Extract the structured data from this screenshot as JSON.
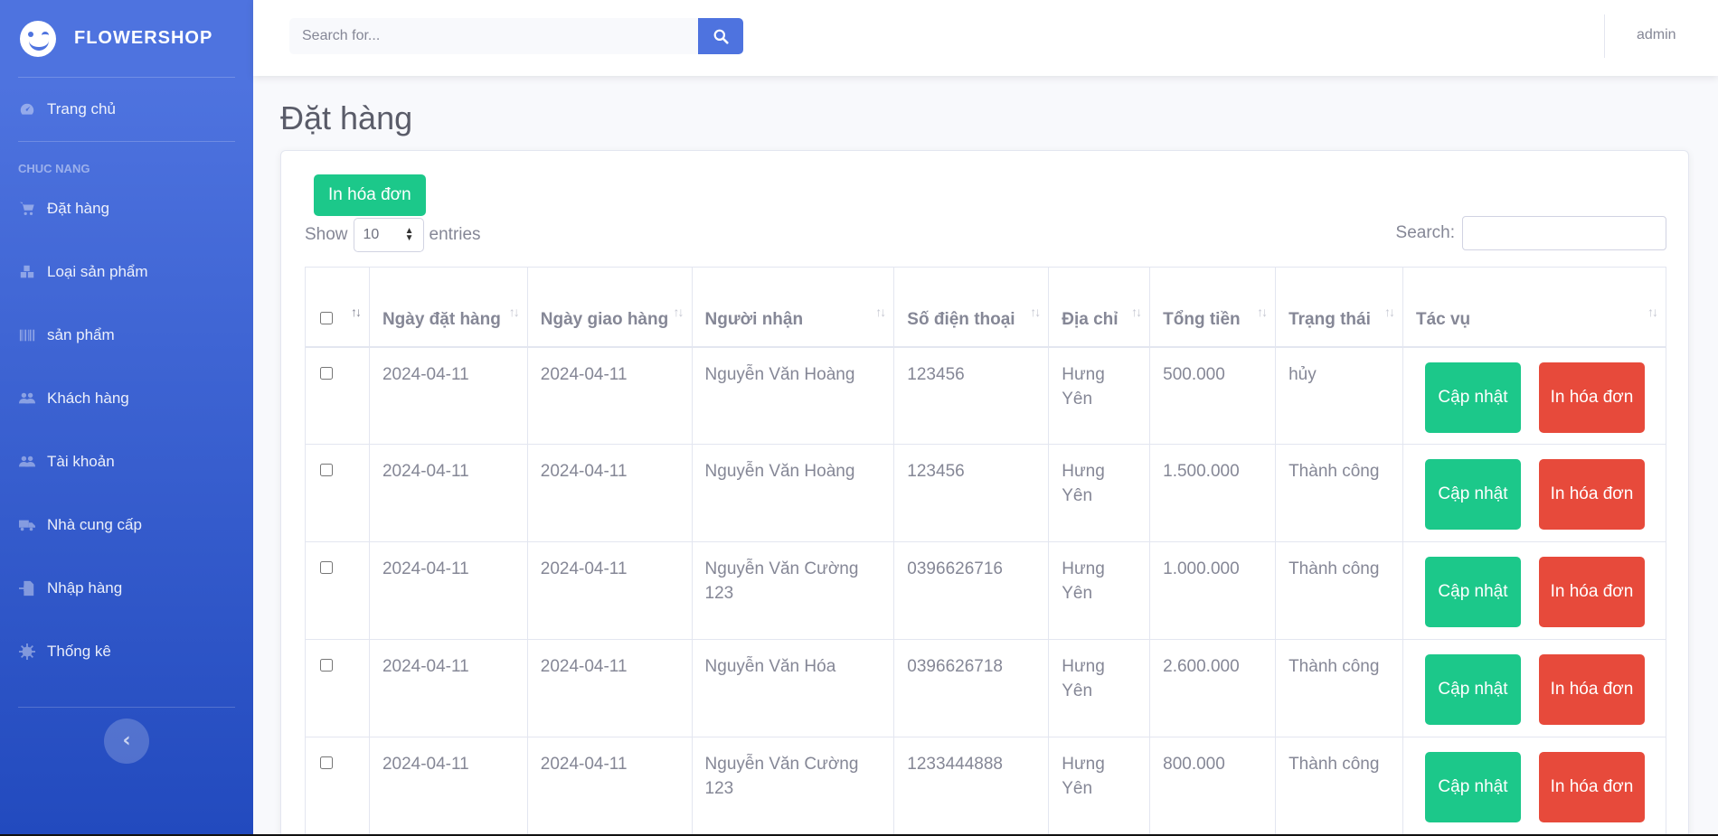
{
  "brand": {
    "name": "FLOWERSHOP"
  },
  "sidebar": {
    "home": "Trang chủ",
    "heading": "CHUC NANG",
    "items": [
      {
        "label": "Đặt hàng",
        "icon": "shopping-cart-icon"
      },
      {
        "label": "Loại sản phẩm",
        "icon": "cubes-icon"
      },
      {
        "label": "sản phẩm",
        "icon": "barcode-icon"
      },
      {
        "label": "Khách hàng",
        "icon": "users-icon"
      },
      {
        "label": "Tài khoản",
        "icon": "users-icon"
      },
      {
        "label": "Nhà cung cấp",
        "icon": "truck-icon"
      },
      {
        "label": "Nhập hàng",
        "icon": "file-import-icon"
      },
      {
        "label": "Thống kê",
        "icon": "cog-icon"
      }
    ]
  },
  "topbar": {
    "search_placeholder": "Search for...",
    "user": "admin"
  },
  "page": {
    "title": "Đặt hàng",
    "print_all_label": "In hóa đơn"
  },
  "datatable": {
    "show_label": "Show",
    "entries_label": "entries",
    "page_length": "10",
    "search_label": "Search:",
    "columns": [
      "Ngày đặt hàng",
      "Ngày giao hàng",
      "Người nhận",
      "Số điện thoại",
      "Địa chỉ",
      "Tổng tiền",
      "Trạng thái",
      "Tác vụ"
    ],
    "rows": [
      {
        "order_date": "2024-04-11",
        "ship_date": "2024-04-11",
        "receiver": "Nguyễn Văn Hoàng",
        "phone": "123456",
        "address": "Hưng Yên",
        "total": "500.000",
        "status": "hủy"
      },
      {
        "order_date": "2024-04-11",
        "ship_date": "2024-04-11",
        "receiver": "Nguyễn Văn Hoàng",
        "phone": "123456",
        "address": "Hưng Yên",
        "total": "1.500.000",
        "status": "Thành công"
      },
      {
        "order_date": "2024-04-11",
        "ship_date": "2024-04-11",
        "receiver": "Nguyễn Văn Cường 123",
        "phone": "0396626716",
        "address": "Hưng Yên",
        "total": "1.000.000",
        "status": "Thành công"
      },
      {
        "order_date": "2024-04-11",
        "ship_date": "2024-04-11",
        "receiver": "Nguyễn Văn Hóa",
        "phone": "0396626718",
        "address": "Hưng Yên",
        "total": "2.600.000",
        "status": "Thành công"
      },
      {
        "order_date": "2024-04-11",
        "ship_date": "2024-04-11",
        "receiver": "Nguyễn Văn Cường 123",
        "phone": "1233444888",
        "address": "Hưng Yên",
        "total": "800.000",
        "status": "Thành công"
      }
    ],
    "update_label": "Cập nhật",
    "print_label": "In hóa đơn"
  },
  "colors": {
    "primary": "#4e73df",
    "success": "#1cc88a",
    "danger": "#e74a3b"
  }
}
